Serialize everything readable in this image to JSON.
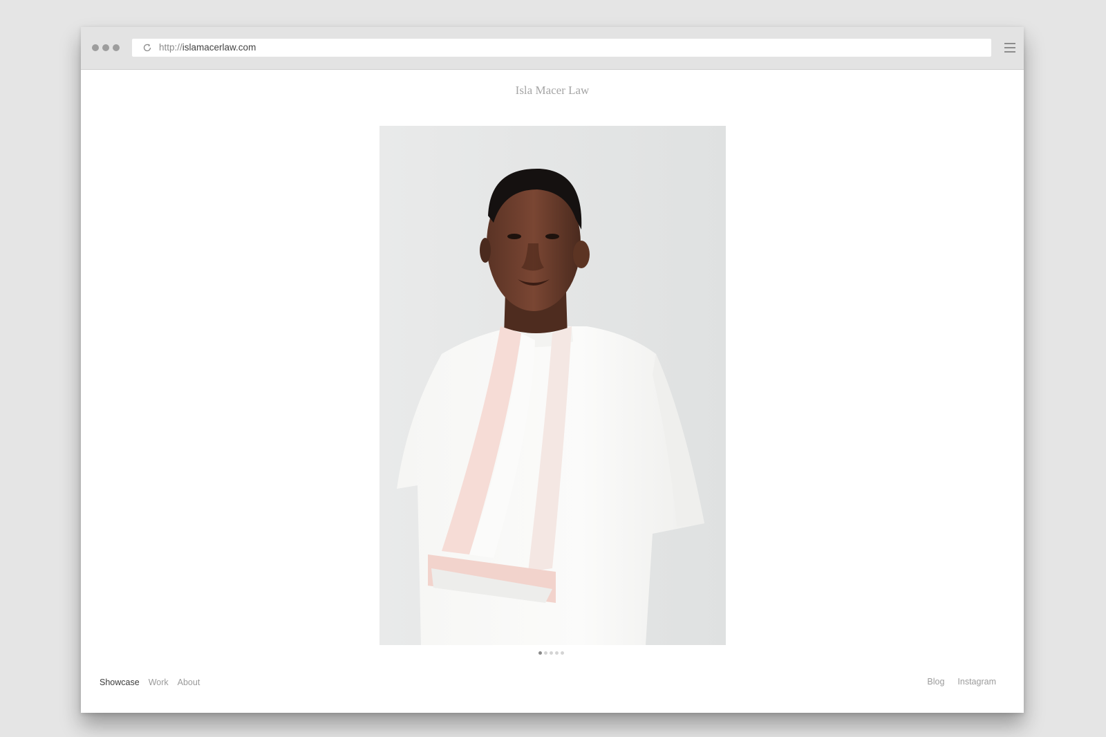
{
  "browser": {
    "url_protocol": "http://",
    "url_host": "islamacerlaw.com"
  },
  "site": {
    "title": "Isla Macer Law"
  },
  "carousel": {
    "count": 5,
    "active_index": 0
  },
  "nav": {
    "left": [
      "Showcase",
      "Work",
      "About"
    ],
    "active": "Showcase",
    "right": [
      "Blog",
      "Instagram"
    ]
  },
  "colors": {
    "page_bg": "#e5e5e5",
    "chrome_bg": "#e3e3e3",
    "title": "#a5a5a5",
    "nav_active": "#3a3a3a",
    "nav_inactive": "#9b9b9b"
  }
}
